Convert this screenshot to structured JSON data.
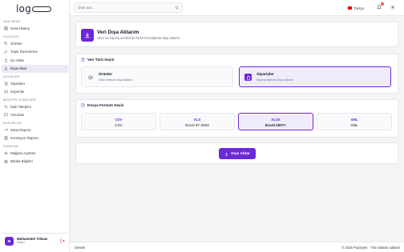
{
  "brand": {
    "logo_text": "log"
  },
  "sidebar": {
    "sections": [
      {
        "title": "ANA MENÜ",
        "items": [
          {
            "label": "Genel Bakış",
            "icon": "grid-icon"
          }
        ]
      },
      {
        "title": "KATALOG",
        "items": [
          {
            "label": "Ürünler",
            "icon": "tag-icon"
          },
          {
            "label": "Toplu Düzenleme",
            "icon": "edit-icon"
          },
          {
            "label": "İçe Aktar",
            "icon": "upload-icon"
          },
          {
            "label": "Dışa Aktar",
            "icon": "download-icon",
            "active": true
          }
        ]
      },
      {
        "title": "SATIŞLAR",
        "items": [
          {
            "label": "Siparişler",
            "icon": "cart-icon"
          },
          {
            "label": "Kuponlar",
            "icon": "ticket-icon"
          }
        ]
      },
      {
        "title": "MÜŞTERİ İLİŞKİLERİ",
        "items": [
          {
            "label": "İade Talepleri",
            "icon": "return-icon"
          },
          {
            "label": "Yorumlar",
            "icon": "comment-icon"
          }
        ]
      },
      {
        "title": "RAPORLAR",
        "items": [
          {
            "label": "Satış Raporu",
            "icon": "trend-icon"
          },
          {
            "label": "Komisyon Raporu",
            "icon": "report-icon"
          }
        ]
      },
      {
        "title": "AYARLAR",
        "items": [
          {
            "label": "Mağaza Ayarları",
            "icon": "settings-icon"
          },
          {
            "label": "Banka Bilgileri",
            "icon": "bank-icon"
          }
        ]
      }
    ],
    "user": {
      "initials": "M",
      "name": "Muhammet Yılmaz",
      "role": "Satıcı"
    }
  },
  "topbar": {
    "search_placeholder": "Ürün ara...",
    "language": "Türkçe",
    "notification_count": "3"
  },
  "page": {
    "title": "Veri Dışa Aktarım",
    "subtitle": "Ürün ve sipariş verilerinizi farklı formatlarda dışa aktarın",
    "data_type_label": "Veri Türü Seçin",
    "data_types": [
      {
        "title": "Ürünler",
        "desc": "Ürün listesini dışa aktarın",
        "selected": false
      },
      {
        "title": "Siparişler",
        "desc": "Sipariş listesini dışa aktarın",
        "selected": true
      }
    ],
    "format_label": "Dosya Formatı Seçin",
    "formats": [
      {
        "code": "CSV",
        "name": "CSV",
        "selected": false
      },
      {
        "code": "XLS",
        "name": "Excel 97-2003",
        "selected": false
      },
      {
        "code": "XLSX",
        "name": "Excel 2007+",
        "selected": true
      },
      {
        "code": "XML",
        "name": "XML",
        "selected": false
      }
    ],
    "export_button": "Dışa Aktar"
  },
  "footer": {
    "left": "Destek",
    "right": "© 2026 Pazaryeri · Tüm hakları saklıdır"
  },
  "colors": {
    "accent": "#6d28d9",
    "accent_soft": "#f1ecfb",
    "badge": "#ef4444"
  }
}
